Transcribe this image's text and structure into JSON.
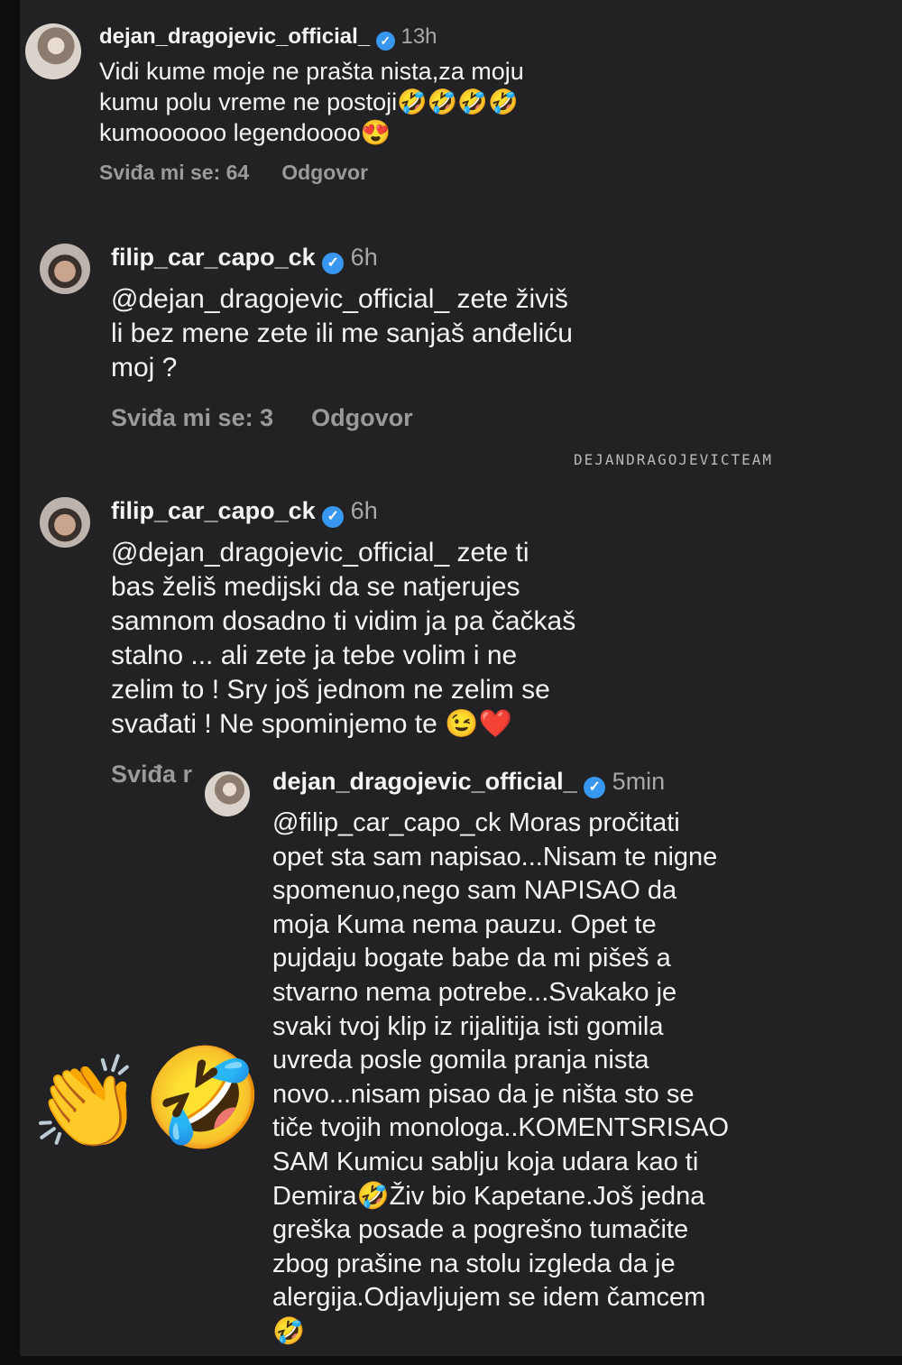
{
  "comments": [
    {
      "username": "dejan_dragojevic_official_",
      "time": "13h",
      "text": "Vidi kume moje ne prašta nista,za moju\nkumu polu vreme ne postoji🤣🤣🤣🤣\nkumoooooo legendoooo😍",
      "likes": "Sviđa mi se: 64",
      "reply": "Odgovor"
    },
    {
      "username": "filip_car_capo_ck",
      "time": "6h",
      "text": "@dejan_dragojevic_official_  zete živiš\nli bez mene zete ili me sanjaš anđeliću\nmoj ?",
      "likes": "Sviđa mi se: 3",
      "reply": "Odgovor"
    },
    {
      "username": "filip_car_capo_ck",
      "time": "6h",
      "text": "@dejan_dragojevic_official_  zete ti\nbas želiš medijski da se natjerujes\nsamnom dosadno ti vidim ja pa čačkaš\nstalno ... ali zete ja tebe volim i ne\nzelim to ! Sry još jednom ne zelim se\nsvađati ! Ne spominjemo te 😉❤️",
      "likes": "Sviđa r"
    },
    {
      "username": "dejan_dragojevic_official_",
      "time": "5min",
      "text": "@filip_car_capo_ck  Moras pročitati\nopet sta sam napisao...Nisam te nigne\nspomenuo,nego sam NAPISAO da\nmoja Kuma nema pauzu.  Opet te\npujdaju bogate babe da mi pišeš a\nstvarno nema potrebe...Svakako je\nsvaki tvoj klip iz rijalitija isti gomila\nuvreda posle gomila pranja nista\nnovo...nisam pisao da je ništa sto se\ntiče tvojih monologa..KOMENTSRISAO\nSAM Kumicu sablju koja udara kao ti\nDemira🤣Živ bio Kapetane.Još jedna\ngreška posade a pogrešno tumačite\nzbog prašine na stolu izgleda da je\nalergija.Odjavljujem se idem čamcem\n🤣"
    }
  ],
  "watermark": "DEJANDRAGOJEVICTEAM",
  "sticker": {
    "clap": "👏",
    "laugh": "🤣"
  },
  "verified_badge": "✓",
  "colors": {
    "background": "#222224",
    "verified": "#3897f0",
    "meta": "#9a9a9a"
  }
}
